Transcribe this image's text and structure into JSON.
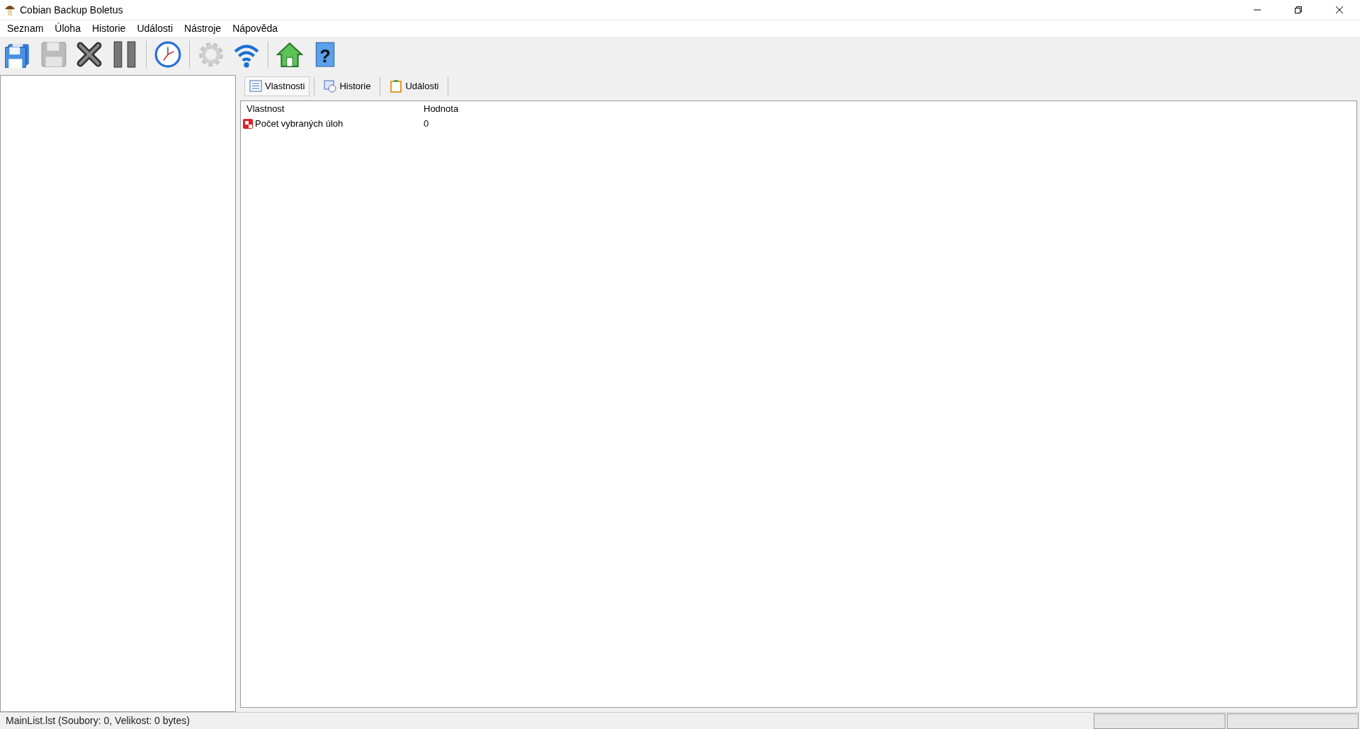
{
  "window": {
    "title": "Cobian Backup Boletus"
  },
  "menu": [
    {
      "label": "Seznam"
    },
    {
      "label": "Úloha"
    },
    {
      "label": "Historie"
    },
    {
      "label": "Události"
    },
    {
      "label": "Nástroje"
    },
    {
      "label": "Nápověda"
    }
  ],
  "toolbar": [
    {
      "kind": "save-all",
      "disabled": false
    },
    {
      "kind": "save",
      "disabled": true
    },
    {
      "kind": "delete",
      "disabled": false
    },
    {
      "kind": "pause",
      "disabled": false
    },
    {
      "kind": "separator"
    },
    {
      "kind": "clock",
      "disabled": false
    },
    {
      "kind": "separator"
    },
    {
      "kind": "gear",
      "disabled": true
    },
    {
      "kind": "wifi",
      "disabled": false
    },
    {
      "kind": "separator"
    },
    {
      "kind": "home",
      "disabled": false
    },
    {
      "kind": "help",
      "label": "?",
      "disabled": false
    }
  ],
  "tabs": [
    {
      "label": "Vlastnosti",
      "kind": "list",
      "selected": true
    },
    {
      "label": "Historie",
      "kind": "history",
      "selected": false
    },
    {
      "label": "Události",
      "kind": "clipboard",
      "selected": false
    }
  ],
  "table": {
    "columns": [
      "Vlastnost",
      "Hodnota"
    ],
    "rows": [
      {
        "cells": [
          "Počet vybraných úloh",
          "0"
        ]
      }
    ]
  },
  "status_bar": {
    "text": "MainList.lst (Soubory: 0, Velikost: 0 bytes)"
  }
}
